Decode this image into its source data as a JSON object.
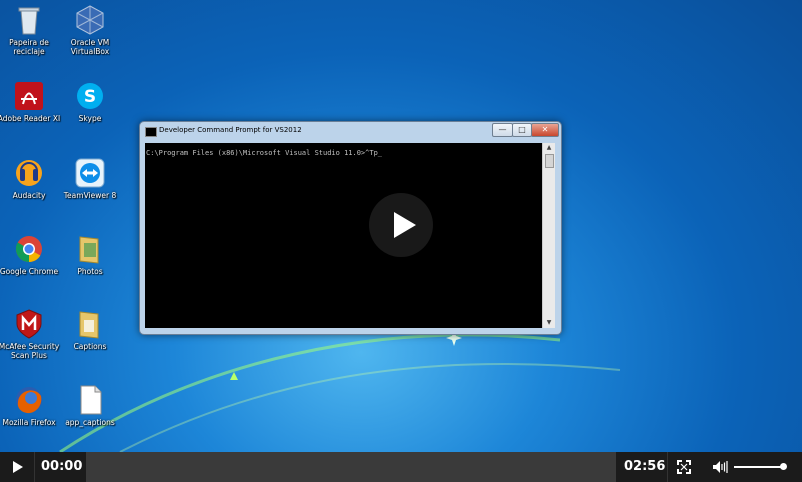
{
  "desktop": {
    "icons": [
      {
        "label": "Papeira de reciclaje",
        "icon": "recycle-bin-icon"
      },
      {
        "label": "Oracle VM VirtualBox",
        "icon": "virtualbox-icon"
      },
      {
        "label": "Adobe Reader XI",
        "icon": "adobe-reader-icon"
      },
      {
        "label": "Skype",
        "icon": "skype-icon"
      },
      {
        "label": "Audacity",
        "icon": "audacity-icon"
      },
      {
        "label": "TeamViewer 8",
        "icon": "teamviewer-icon"
      },
      {
        "label": "Google Chrome",
        "icon": "chrome-icon"
      },
      {
        "label": "Photos",
        "icon": "folder-icon"
      },
      {
        "label": "McAfee Security Scan Plus",
        "icon": "mcafee-icon"
      },
      {
        "label": "Captions",
        "icon": "folder-icon"
      },
      {
        "label": "Mozilla Firefox",
        "icon": "firefox-icon"
      },
      {
        "label": "app_captions",
        "icon": "document-icon"
      }
    ]
  },
  "window": {
    "title": "Developer Command Prompt for VS2012",
    "console_text": "C:\\Program Files (x86)\\Microsoft Visual Studio 11.0>^Tp_",
    "minimize": "—",
    "maximize": "□",
    "close": "✕"
  },
  "player": {
    "current_time": "00:00",
    "duration": "02:56",
    "progress": 0,
    "volume": 0.9
  },
  "colors": {
    "desktop_blue": "#0b63b8",
    "control_bar": "#1b1b1b"
  }
}
